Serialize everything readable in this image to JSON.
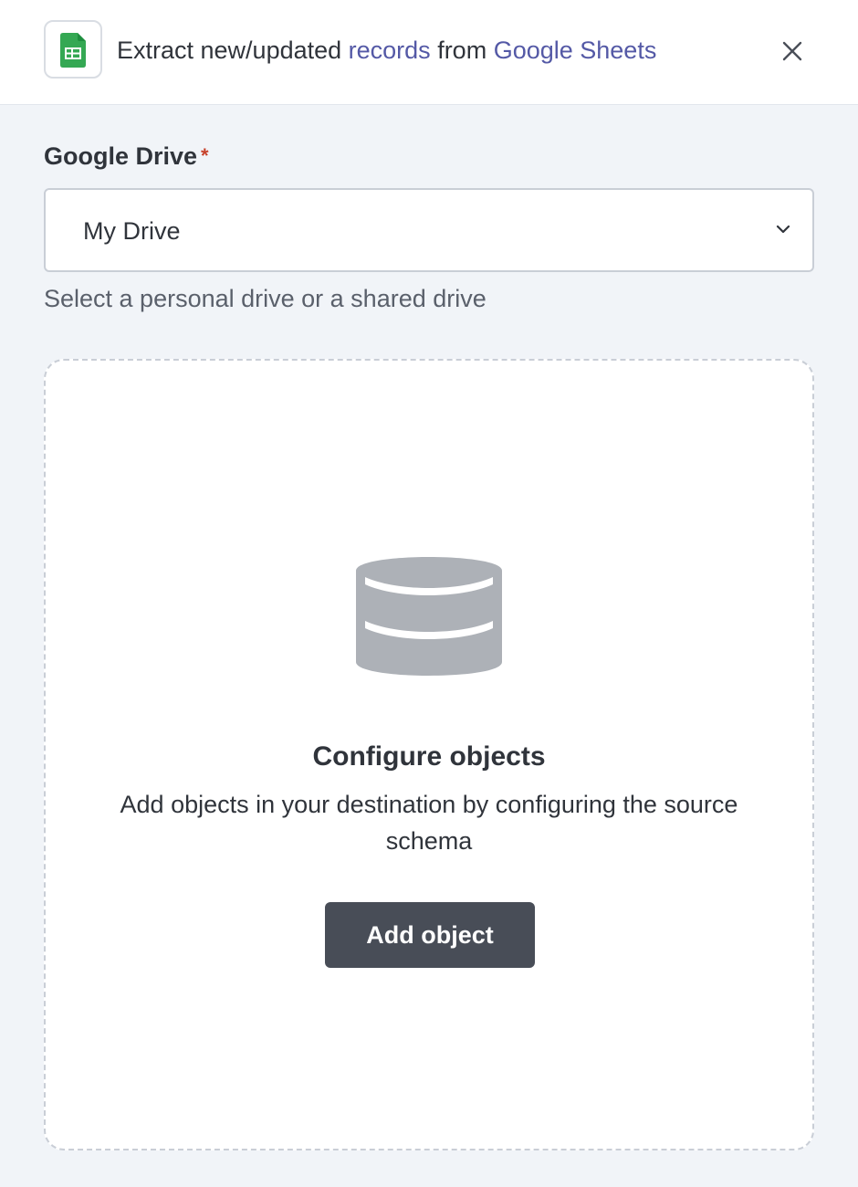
{
  "header": {
    "app_icon": "google-sheets-icon",
    "title_prefix": "Extract new/updated ",
    "title_link_records": "records",
    "title_middle": " from ",
    "title_link_source": "Google Sheets",
    "close_icon": "close-icon"
  },
  "form": {
    "drive_label": "Google Drive",
    "required_marker": "*",
    "drive_selected": "My Drive",
    "drive_helper": "Select a personal drive or a shared drive",
    "dropdown_icon": "chevron-down-icon"
  },
  "empty_state": {
    "icon": "database-icon",
    "title": "Configure objects",
    "description": "Add objects in your destination by configuring the source schema",
    "button_label": "Add object"
  },
  "colors": {
    "link": "#5459a6",
    "required": "#c7422b",
    "button_bg": "#484d57",
    "sheets_green": "#34a853",
    "background": "#f1f4f8"
  }
}
